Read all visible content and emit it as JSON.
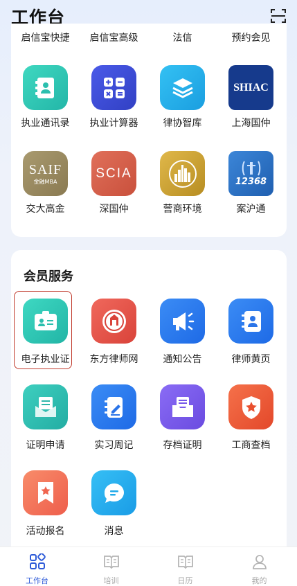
{
  "header": {
    "title": "工作台",
    "scan_icon": "scan-icon"
  },
  "top_row": [
    "启信宝快捷",
    "启信宝高级",
    "法信",
    "预约会见"
  ],
  "tools_row1": [
    {
      "label": "执业通讯录",
      "icon": "contact-book-icon",
      "color": "#2fc7b5"
    },
    {
      "label": "执业计算器",
      "icon": "calculator-icon",
      "color": "#3b4fd6"
    },
    {
      "label": "律协智库",
      "icon": "layers-icon",
      "color": "#1faee8"
    },
    {
      "label": "上海国仲",
      "icon": "shiac-logo-icon",
      "color": "#163a8c",
      "text": "SHIAC"
    }
  ],
  "tools_row2": [
    {
      "label": "交大高金",
      "icon": "saif-logo-icon",
      "color": "#9b8a5f",
      "text": "SAIF",
      "sub": "金融MBA"
    },
    {
      "label": "深国仲",
      "icon": "scia-logo-icon",
      "color": "#d9604a",
      "text": "SCIA"
    },
    {
      "label": "营商环境",
      "icon": "city-skyline-icon",
      "color": "#d3a836"
    },
    {
      "label": "案沪通",
      "icon": "hotline-12368-icon",
      "color": "#2c6fc4",
      "text": "12368"
    }
  ],
  "member": {
    "title": "会员服务",
    "row1": [
      {
        "label": "电子执业证",
        "icon": "id-card-icon",
        "color": "#2ec9b3"
      },
      {
        "label": "东方律师网",
        "icon": "seal-emblem-icon",
        "color": "#e65248"
      },
      {
        "label": "通知公告",
        "icon": "megaphone-icon",
        "color": "#2f7ff0"
      },
      {
        "label": "律师黄页",
        "icon": "yellow-pages-icon",
        "color": "#2d7ef2"
      }
    ],
    "row2": [
      {
        "label": "证明申请",
        "icon": "certificate-envelope-icon",
        "color": "#2fbeb0"
      },
      {
        "label": "实习周记",
        "icon": "journal-pen-icon",
        "color": "#2c7cf0"
      },
      {
        "label": "存档证明",
        "icon": "archive-tray-icon",
        "color": "#7b5cf0"
      },
      {
        "label": "工商查档",
        "icon": "shield-star-icon",
        "color": "#ef5a35"
      }
    ],
    "row3": [
      {
        "label": "活动报名",
        "icon": "bookmark-star-icon",
        "color": "#f3705a"
      },
      {
        "label": "消息",
        "icon": "chat-bubble-icon",
        "color": "#23a9f0"
      }
    ]
  },
  "bottom_nav": [
    {
      "label": "工作台",
      "icon": "grid-apps-icon",
      "active": true
    },
    {
      "label": "培训",
      "icon": "open-book-icon",
      "active": false
    },
    {
      "label": "日历",
      "icon": "open-book-icon",
      "active": false
    },
    {
      "label": "我的",
      "icon": "person-icon",
      "active": false
    }
  ]
}
